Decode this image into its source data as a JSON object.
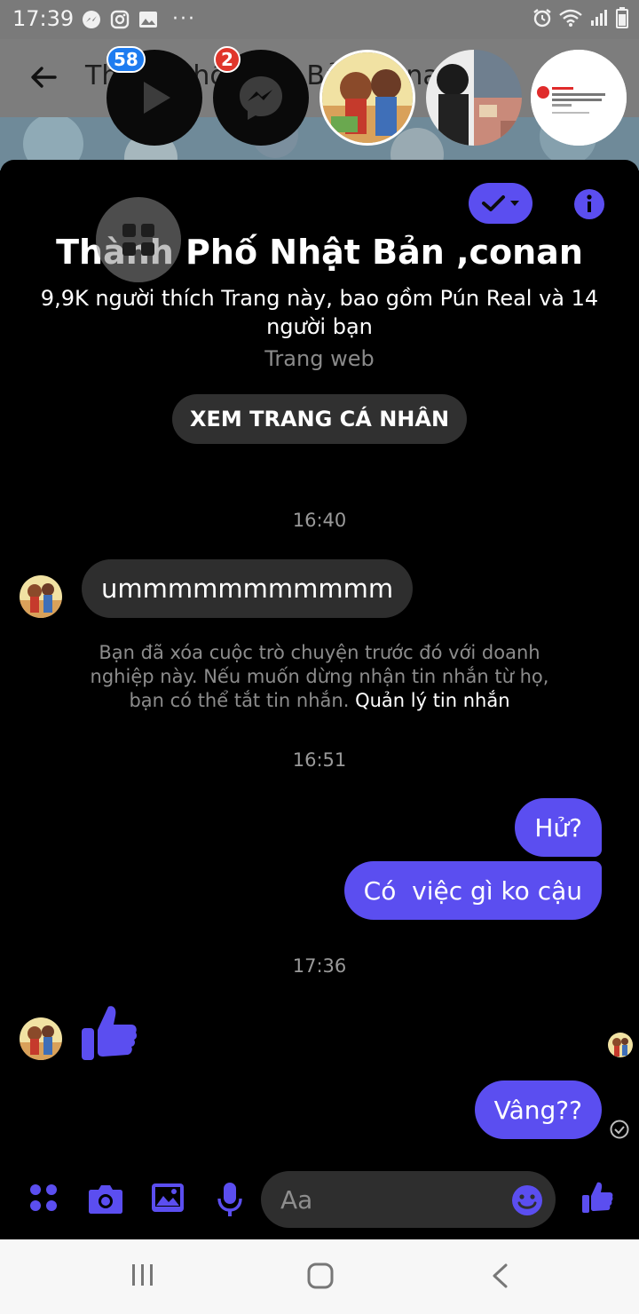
{
  "status_bar": {
    "time": "17:39",
    "more": "···"
  },
  "header": {
    "title": "Thành Phố Nhật Bản ,conan"
  },
  "chat_heads": [
    {
      "badge": "58",
      "icon": "play-icon"
    },
    {
      "badge": "2",
      "icon": "messenger-icon"
    }
  ],
  "profile": {
    "name": "Thành Phố Nhật Bản ,conan",
    "likes": "9,9K người thích Trang này, bao gồm Pún Real và 14 người bạn",
    "category": "Trang web",
    "view_profile_label": "XEM TRANG CÁ NHÂN"
  },
  "messages": {
    "ts1": "16:40",
    "incoming_1": "ummmmmmmmmmm",
    "notice": "Bạn đã xóa cuộc trò chuyện trước đó với doanh nghiệp này. Nếu muốn dừng nhận tin nhắn từ họ, bạn có thể tắt tin nhắn.",
    "notice_link": "Quản lý tin nhắn",
    "ts2": "16:51",
    "outgoing_1": "Hử?",
    "outgoing_2": "Có  việc gì ko cậu",
    "ts3": "17:36",
    "outgoing_3": "Vâng??"
  },
  "composer": {
    "placeholder": "Aa"
  },
  "colors": {
    "accent": "#5b4ef0",
    "bubble_incoming": "#2e2e2e",
    "background": "#000000",
    "badge_blue": "#1e7cf0",
    "badge_red": "#e0362b"
  }
}
